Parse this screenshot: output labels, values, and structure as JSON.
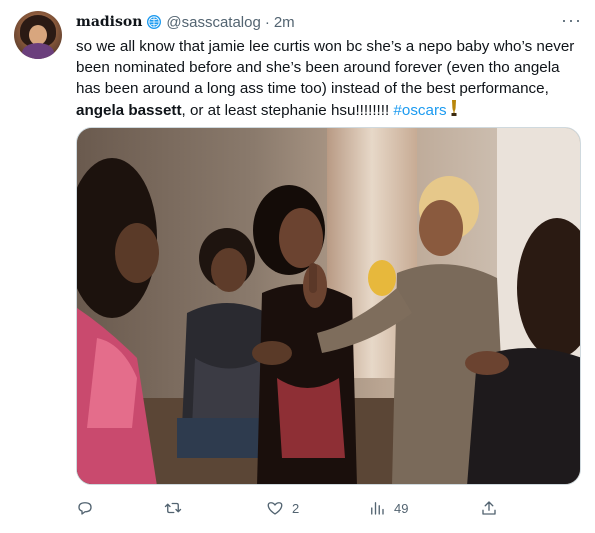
{
  "tweet": {
    "display_name": "madison",
    "handle": "@sasscatalog",
    "separator": "·",
    "time": "2m",
    "more_label": "···",
    "text_lines": {
      "line1": "so we all know that jamie lee curtis won bc she’s a nepo baby who’s never",
      "line2": "been nominated before and she’s been around forever (even tho angela",
      "line3": "has been around a long ass time too) instead of the best performance,",
      "line4_bold": "angela bassett",
      "line4_rest": ", or at least stephanie hsu!!!!!!!! ",
      "hashtag": "#oscars"
    },
    "media_icon": "photo-of-women-arguing",
    "actions": {
      "reply": {
        "icon": "reply-icon",
        "count": ""
      },
      "retweet": {
        "icon": "retweet-icon",
        "count": ""
      },
      "like": {
        "icon": "heart-icon",
        "count": "2"
      },
      "views": {
        "icon": "views-icon",
        "count": "49"
      },
      "share": {
        "icon": "share-icon"
      }
    },
    "colors": {
      "hashtag": "#1d9bf0",
      "secondary_text": "#536471",
      "verified_badge": "#1d9bf0"
    }
  }
}
